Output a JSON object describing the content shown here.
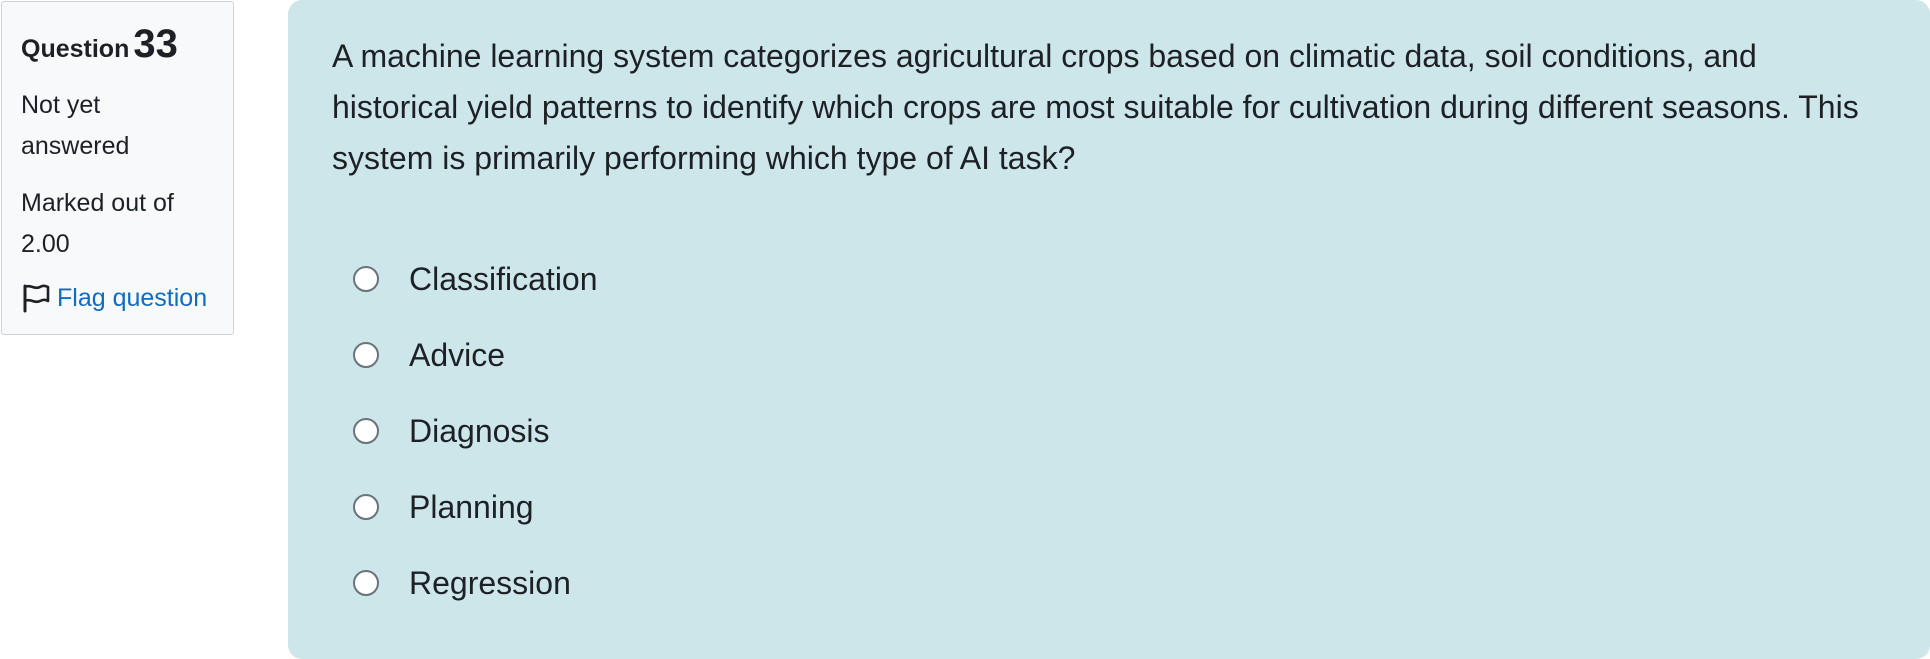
{
  "info": {
    "question_label": "Question",
    "question_number": "33",
    "state": "Not yet answered",
    "grade": "Marked out of 2.00",
    "flag_label": "Flag question"
  },
  "question": {
    "text": "A machine learning system categorizes agricultural crops based on climatic data, soil conditions, and historical yield patterns to identify which crops are most suitable for cultivation during different seasons. This system is primarily performing which type of AI task?",
    "answers": [
      {
        "label": "Classification"
      },
      {
        "label": "Advice"
      },
      {
        "label": "Diagnosis"
      },
      {
        "label": "Planning"
      },
      {
        "label": "Regression"
      }
    ]
  },
  "colors": {
    "content_bg": "#cde6ea",
    "info_bg": "#f8f9fa",
    "link": "#0f6cbf"
  },
  "icons": {
    "flag": "flag-icon"
  }
}
